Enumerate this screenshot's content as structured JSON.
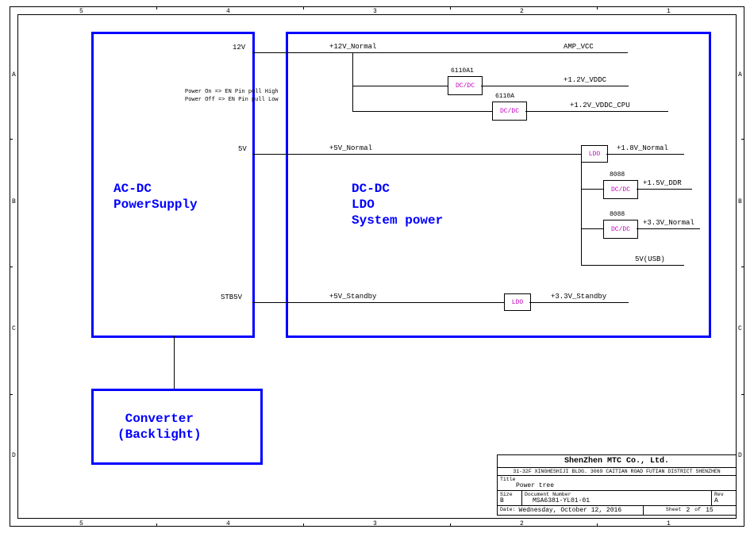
{
  "blocks": {
    "acdc": {
      "line1": "AC-DC",
      "line2": "PowerSupply"
    },
    "dcdc": {
      "line1": "DC-DC",
      "line2": "LDO",
      "line3": "System power"
    },
    "conv": {
      "line1": "Converter",
      "line2": "(Backlight)"
    }
  },
  "rails": {
    "r12v": "12V",
    "r5v": "5V",
    "rstb": "STB5V"
  },
  "nets": {
    "p12n": "+12V_Normal",
    "ampvcc": "AMP_VCC",
    "v12c": "+1.2V_VDDC",
    "v12cpu": "+1.2V_VDDC_CPU",
    "p5n": "+5V_Normal",
    "v18n": "+1.8V_Normal",
    "v15d": "+1.5V_DDR",
    "v33n": "+3.3V_Normal",
    "v5usb": "5V(USB)",
    "p5s": "+5V_Standby",
    "v33s": "+3.3V_Standby"
  },
  "refs": {
    "u1": "6110A1",
    "u2": "6110A",
    "u3": "8088",
    "u4": "8088"
  },
  "comp": {
    "dcdc": "DC/DC",
    "ldo": "LDO"
  },
  "notes": {
    "on": "Power On  => EN Pin pull High",
    "off": "Power Off => EN Pin pull Low"
  },
  "titleblock": {
    "company": "ShenZhen MTC Co., Ltd.",
    "address": "31-32F XINGHESHIJI BLDG. 3069 CAITIAN ROAD FUTIAN DISTRICT SHENZHEN",
    "title_lbl": "Title",
    "title": "Power tree",
    "size_lbl": "Size",
    "size": "B",
    "docnum_lbl": "Document Number",
    "docnum": "MSA6381-YL01-01",
    "rev_lbl": "Rev",
    "rev": "A",
    "date_lbl": "Date:",
    "date": "Wednesday, October 12, 2016",
    "sheet_lbl": "Sheet",
    "sheet_cur": "2",
    "sheet_of": "of",
    "sheet_tot": "15"
  },
  "ruler": {
    "top": [
      "5",
      "4",
      "3",
      "2",
      "1"
    ],
    "bottom": [
      "5",
      "4",
      "3",
      "2",
      "1"
    ],
    "left": [
      "A",
      "B",
      "C",
      "D"
    ],
    "right": [
      "A",
      "B",
      "C",
      "D"
    ]
  }
}
